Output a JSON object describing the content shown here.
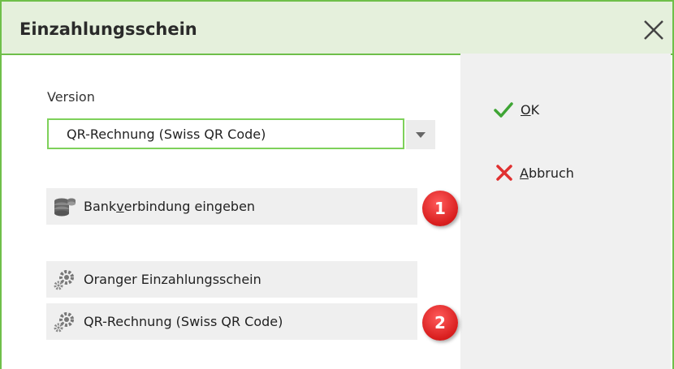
{
  "dialog": {
    "title": "Einzahlungsschein",
    "close_icon": "close-icon"
  },
  "version": {
    "label": "Version",
    "selected": "QR-Rechnung (Swiss QR Code)"
  },
  "actions": {
    "ok": {
      "underlined": "O",
      "rest": "K",
      "icon": "check-icon",
      "color": "#3fa535"
    },
    "cancel": {
      "underlined": "A",
      "rest": "bbruch",
      "icon": "cross-icon",
      "color": "#e03030"
    }
  },
  "rows": {
    "bank": {
      "before": "Bank",
      "underlined": "v",
      "after": "erbindung eingeben",
      "icon": "coins-icon"
    },
    "orange": {
      "label": "Oranger Einzahlungsschein",
      "icon": "gears-icon"
    },
    "qr": {
      "label": "QR-Rechnung (Swiss QR Code)",
      "icon": "gears-icon"
    }
  },
  "badges": [
    "1",
    "2"
  ],
  "colors": {
    "accent_green": "#6fbf4a",
    "title_bg": "#e5f0dc",
    "badge_red": "#d81e1e"
  }
}
